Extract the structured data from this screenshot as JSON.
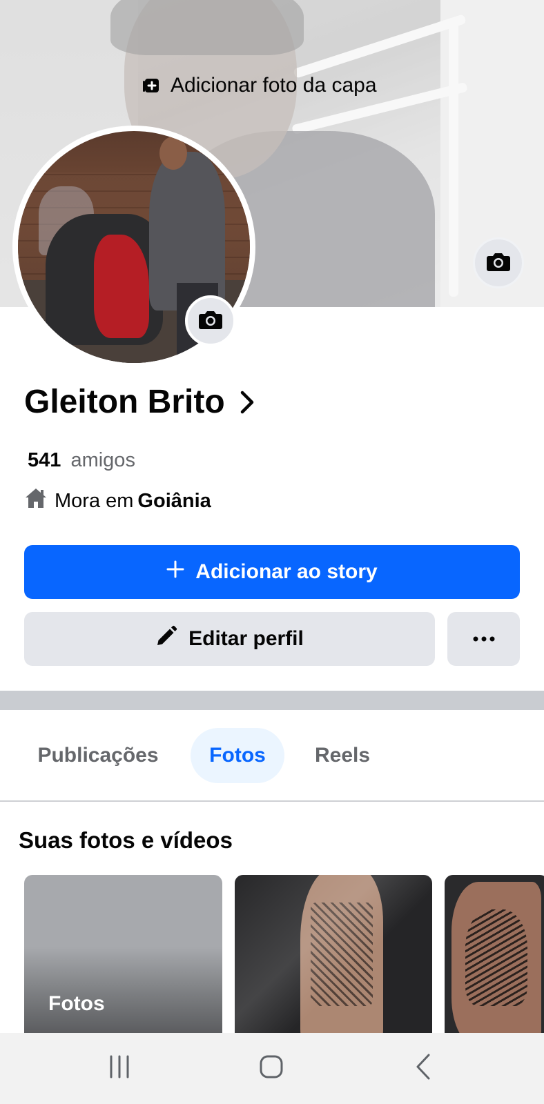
{
  "cover": {
    "add_cover_label": "Adicionar foto da capa",
    "add_icon": "add-photo-icon",
    "camera_icon": "camera-icon"
  },
  "avatar": {
    "camera_icon": "camera-icon"
  },
  "profile": {
    "name": "Gleiton Brito",
    "name_chevron_icon": "chevron-right-icon",
    "friends_count": "541",
    "friends_label": "amigos",
    "location_icon": "home-icon",
    "location_prefix": "Mora em",
    "location_city": "Goiânia"
  },
  "actions": {
    "add_story_label": "Adicionar ao story",
    "add_story_icon": "plus-icon",
    "edit_profile_label": "Editar perfil",
    "edit_profile_icon": "pencil-icon",
    "more_icon": "more-icon",
    "primary_color": "#0866ff",
    "secondary_color": "#e4e6eb"
  },
  "tabs": [
    {
      "label": "Publicações",
      "active": false
    },
    {
      "label": "Fotos",
      "active": true
    },
    {
      "label": "Reels",
      "active": false
    }
  ],
  "photos_section": {
    "title": "Suas fotos e vídeos",
    "cards": [
      {
        "label": "Fotos"
      }
    ]
  },
  "navbar": {
    "recents_icon": "recents-icon",
    "home_icon": "home-button-icon",
    "back_icon": "back-icon"
  }
}
